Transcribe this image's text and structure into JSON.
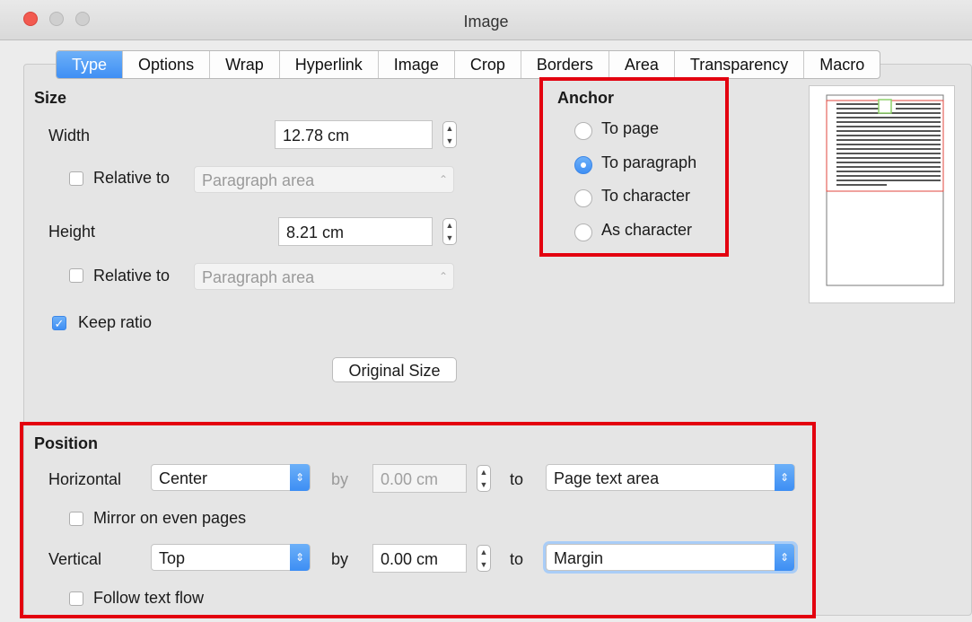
{
  "window": {
    "title": "Image",
    "topclip": "…"
  },
  "tabs": [
    "Type",
    "Options",
    "Wrap",
    "Hyperlink",
    "Image",
    "Crop",
    "Borders",
    "Area",
    "Transparency",
    "Macro"
  ],
  "size": {
    "heading": "Size",
    "width_label": "Width",
    "width_value": "12.78 cm",
    "width_relative_label": "Relative to",
    "width_relative_value": "Paragraph area",
    "height_label": "Height",
    "height_value": "8.21 cm",
    "height_relative_label": "Relative to",
    "height_relative_value": "Paragraph area",
    "keep_ratio_label": "Keep ratio",
    "original_size_button": "Original Size"
  },
  "anchor": {
    "heading": "Anchor",
    "options": [
      "To page",
      "To paragraph",
      "To character",
      "As character"
    ],
    "selected": "To paragraph"
  },
  "position": {
    "heading": "Position",
    "horizontal_label": "Horizontal",
    "horizontal_value": "Center",
    "horizontal_by_label": "by",
    "horizontal_by_value": "0.00 cm",
    "horizontal_to_label": "to",
    "horizontal_to_value": "Page text area",
    "mirror_label": "Mirror on even pages",
    "vertical_label": "Vertical",
    "vertical_value": "Top",
    "vertical_by_label": "by",
    "vertical_by_value": "0.00 cm",
    "vertical_to_label": "to",
    "vertical_to_value": "Margin",
    "follow_label": "Follow text flow"
  },
  "colors": {
    "accent": "#3f8ff4",
    "highlight_box": "#e3000f",
    "close_button": "#f25a50"
  }
}
